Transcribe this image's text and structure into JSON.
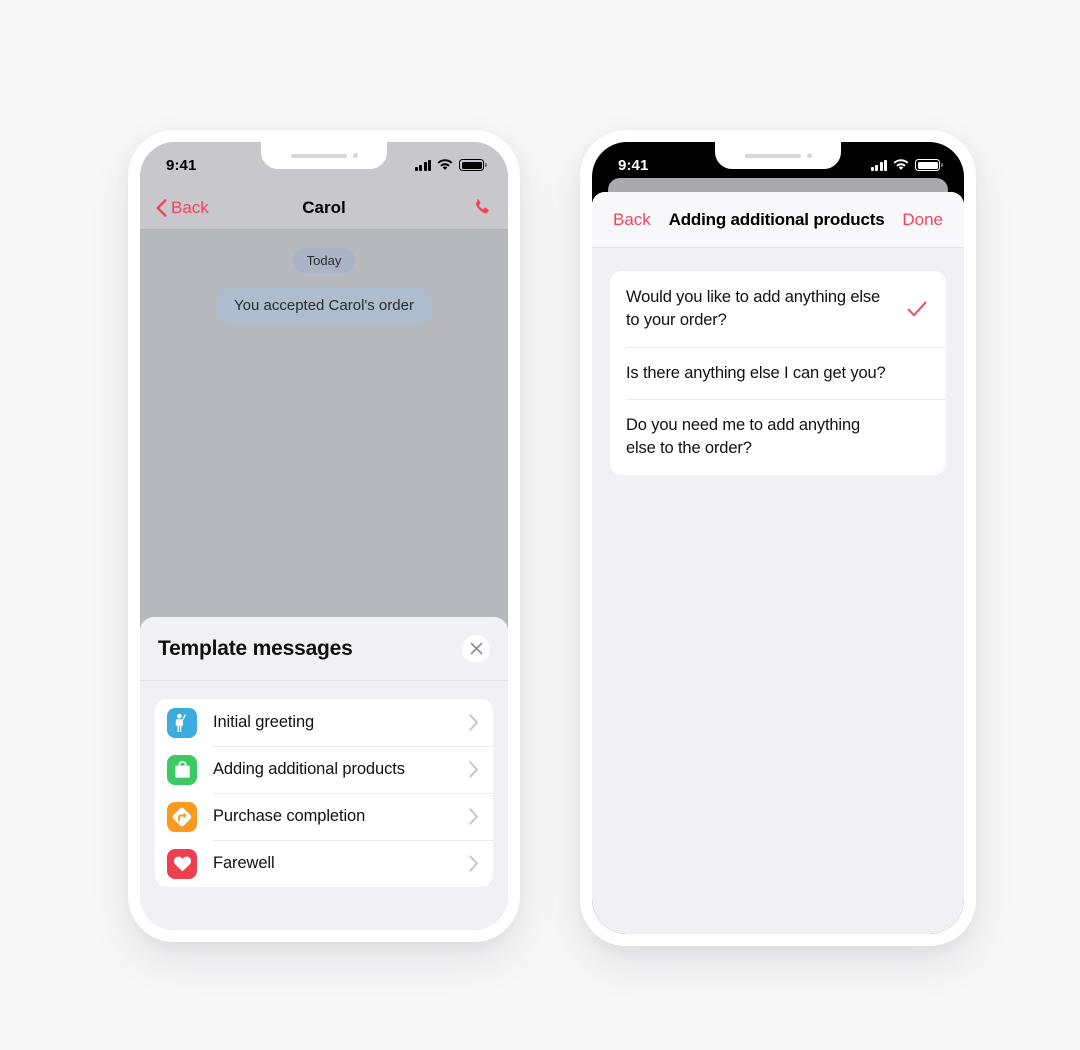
{
  "meta": {
    "canvas_background": "#f7f7f8",
    "accent_red": "#f4445b"
  },
  "phone_left": {
    "status_bar": {
      "time": "9:41",
      "icons": [
        "cellular-signal-icon",
        "wifi-icon",
        "battery-icon"
      ]
    },
    "navbar": {
      "back_label": "Back",
      "title": "Carol",
      "call_icon": "phone-call-icon"
    },
    "chat": {
      "day_divider": "Today",
      "system_message": "You accepted Carol's order"
    },
    "template_sheet": {
      "title": "Template messages",
      "close_icon": "close-icon",
      "items": [
        {
          "label": "Initial greeting",
          "icon": "waving-person-icon",
          "icon_color": "#3cabdf"
        },
        {
          "label": "Adding additional products",
          "icon": "shopping-bag-icon",
          "icon_color": "#3bc964"
        },
        {
          "label": "Purchase completion",
          "icon": "direction-sign-icon",
          "icon_color": "#f79a1e"
        },
        {
          "label": "Farewell",
          "icon": "heart-icon",
          "icon_color": "#ef4050"
        }
      ]
    }
  },
  "phone_right": {
    "status_bar": {
      "time": "9:41",
      "icons": [
        "cellular-signal-icon",
        "wifi-icon",
        "battery-icon"
      ]
    },
    "modal": {
      "back_label": "Back",
      "title": "Adding additional products",
      "done_label": "Done",
      "options": [
        {
          "text": "Would you like to add anything else to your order?",
          "selected": true
        },
        {
          "text": "Is there anything else I can get you?",
          "selected": false
        },
        {
          "text": "Do you need me to add anything else to the order?",
          "selected": false
        }
      ]
    }
  }
}
